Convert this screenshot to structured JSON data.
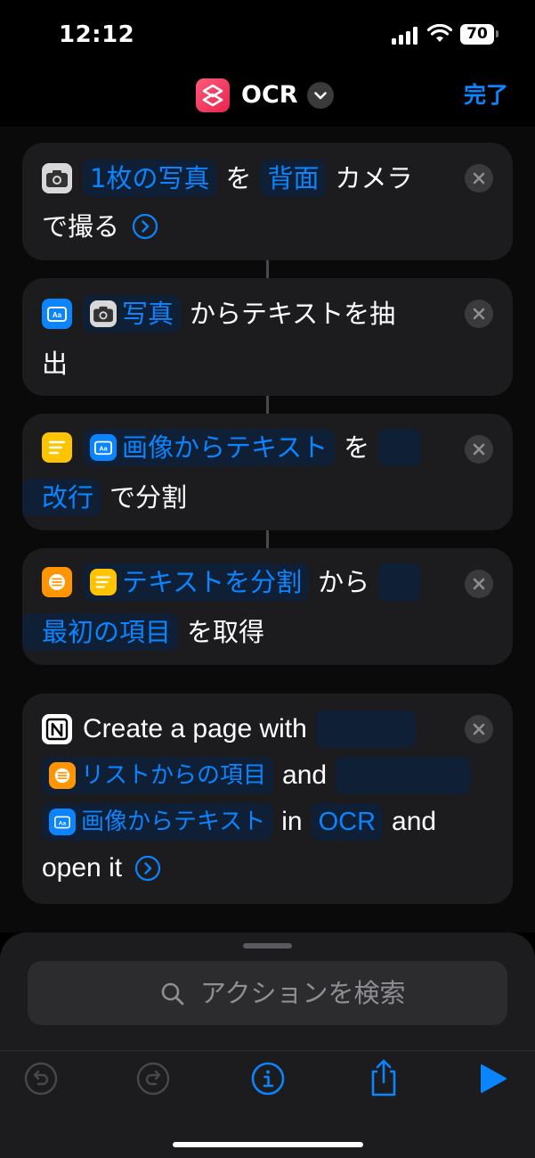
{
  "status_bar": {
    "time": "12:12",
    "battery": "70"
  },
  "nav": {
    "title": "OCR",
    "done_label": "完了"
  },
  "actions": [
    {
      "lines": [
        [
          "1枚の写真",
          "を",
          "背面",
          "カメラ"
        ],
        [
          "で撮る"
        ]
      ]
    },
    {
      "lines": [
        [
          "写真",
          "からテキストを抽"
        ],
        [
          "出"
        ]
      ]
    },
    {
      "lines": [
        [
          "画像からテキスト",
          "を"
        ],
        [
          "改行",
          "で分割"
        ]
      ]
    },
    {
      "lines": [
        [
          "テキストを分割",
          "から"
        ],
        [
          "最初の項目",
          "を取得"
        ]
      ]
    },
    {
      "lines": [
        [
          "Create a page with"
        ],
        [
          "リストからの項目",
          "and"
        ],
        [
          "画像からテキスト",
          "in",
          "OCR",
          "and"
        ],
        [
          "open it"
        ]
      ]
    }
  ],
  "bottom_sheet": {
    "search_placeholder": "アクションを検索"
  },
  "icons": {
    "camera": "camera-icon",
    "text_from_image": "text-from-image-icon",
    "split_text": "split-text-icon",
    "list": "list-icon",
    "notion": "notion-icon"
  },
  "colors": {
    "accent": "#0a84ff",
    "background": "#000000",
    "card": "#1c1c1e"
  }
}
